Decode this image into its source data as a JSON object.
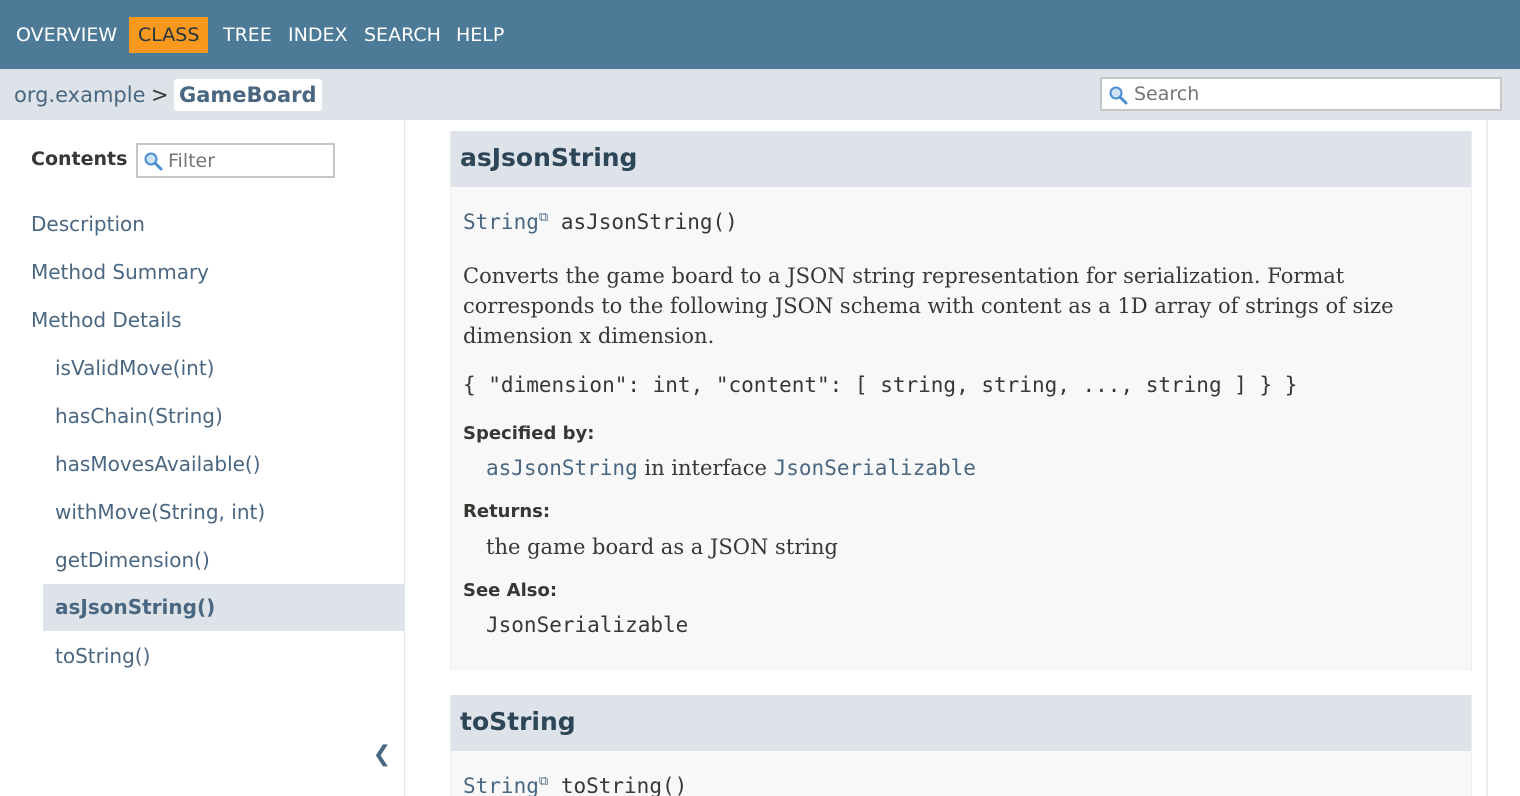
{
  "nav": {
    "items": [
      "OVERVIEW",
      "CLASS",
      "TREE",
      "INDEX",
      "SEARCH",
      "HELP"
    ],
    "active": "CLASS"
  },
  "breadcrumb": {
    "package": "org.example",
    "separator": ">",
    "class": "GameBoard"
  },
  "search": {
    "placeholder": "Search"
  },
  "sidebar": {
    "title": "Contents",
    "filter_placeholder": "Filter",
    "items": [
      {
        "label": "Description"
      },
      {
        "label": "Method Summary"
      },
      {
        "label": "Method Details"
      },
      {
        "label": "isValidMove(int)"
      },
      {
        "label": "hasChain(String)"
      },
      {
        "label": "hasMovesAvailable()"
      },
      {
        "label": "withMove(String, int)"
      },
      {
        "label": "getDimension()"
      },
      {
        "label": "asJsonString()"
      },
      {
        "label": "toString()"
      }
    ],
    "active": "asJsonString()",
    "collapse_glyph": "❮"
  },
  "method1": {
    "name": "asJsonString",
    "return_type": "String",
    "signature": "asJsonString()",
    "description": "Converts the game board to a JSON string representation for serialization. Format corresponds to the following JSON schema with content as a 1D array of strings of size dimension x dimension.",
    "code": "{ \"dimension\": int, \"content\": [ string, string, ..., string ] } }",
    "specified_by_label": "Specified by:",
    "specified_method": "asJsonString",
    "specified_text": " in interface ",
    "specified_interface": "JsonSerializable",
    "returns_label": "Returns:",
    "returns_text": "the game board as a JSON string",
    "see_also_label": "See Also:",
    "see_also_link": "JsonSerializable"
  },
  "method2": {
    "name": "toString",
    "return_type": "String",
    "signature": "toString()"
  },
  "icons": {
    "external": "⧉",
    "search": "search-icon"
  },
  "colors": {
    "nav_bg": "#4d7a97",
    "nav_active": "#f8981d",
    "subnav_bg": "#dee3e9",
    "link": "#4a6782"
  }
}
